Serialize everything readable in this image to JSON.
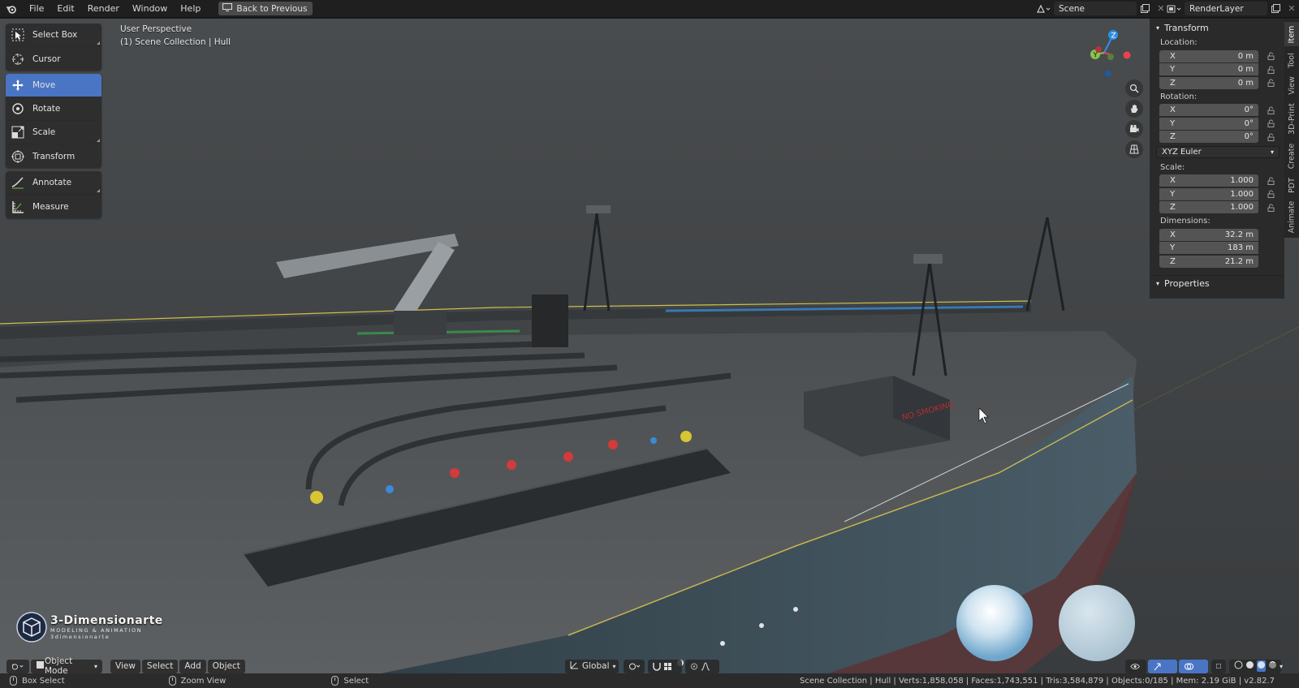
{
  "topbar": {
    "menus": [
      "File",
      "Edit",
      "Render",
      "Window",
      "Help"
    ],
    "back_button": "Back to Previous",
    "scene": "Scene",
    "view_layer": "RenderLayer"
  },
  "viewport": {
    "perspective_label": "User Perspective",
    "collection_label": "(1) Scene Collection | Hull",
    "deck_sign_text": "NO SMOKING"
  },
  "toolbar": {
    "tools": [
      {
        "label": "Select Box",
        "icon": "select-box-icon"
      },
      {
        "label": "Cursor",
        "icon": "cursor-icon"
      },
      {
        "label": "Move",
        "icon": "move-icon",
        "active": true
      },
      {
        "label": "Rotate",
        "icon": "rotate-icon"
      },
      {
        "label": "Scale",
        "icon": "scale-icon"
      },
      {
        "label": "Transform",
        "icon": "transform-icon"
      },
      {
        "label": "Annotate",
        "icon": "annotate-icon"
      },
      {
        "label": "Measure",
        "icon": "measure-icon"
      }
    ]
  },
  "gizmo": {
    "x": "X",
    "y": "Y",
    "z": "Z"
  },
  "npanel": {
    "transform_title": "Transform",
    "location_label": "Location:",
    "location": {
      "x": "0 m",
      "y": "0 m",
      "z": "0 m"
    },
    "rotation_label": "Rotation:",
    "rotation": {
      "x": "0°",
      "y": "0°",
      "z": "0°"
    },
    "rotation_mode": "XYZ Euler",
    "scale_label": "Scale:",
    "scale": {
      "x": "1.000",
      "y": "1.000",
      "z": "1.000"
    },
    "dimensions_label": "Dimensions:",
    "dimensions": {
      "x": "32.2 m",
      "y": "183 m",
      "z": "21.2 m"
    },
    "properties_title": "Properties",
    "axis_x": "X",
    "axis_y": "Y",
    "axis_z": "Z"
  },
  "side_tabs": [
    "Item",
    "Tool",
    "View",
    "3D-Print",
    "Create",
    "PDT",
    "Animate"
  ],
  "header": {
    "mode": "Object Mode",
    "menus": [
      "View",
      "Select",
      "Add",
      "Object"
    ],
    "orientation": "Global"
  },
  "watermark": {
    "title": "3-Dimensionarte",
    "subtitle": "MODELING & ANIMATION",
    "url": "3dimensionarte"
  },
  "statusbar": {
    "left_action": "Box Select",
    "middle_action": "Zoom View",
    "right_action": "Select",
    "stats": "Scene Collection | Hull | Verts:1,858,058 | Faces:1,743,551 | Tris:3,584,879 | Objects:0/185 | Mem: 2.19 GiB | v2.82.7"
  },
  "colors": {
    "active_tool": "#4a75c4",
    "axis_x": "#e8434f",
    "axis_y": "#8bc34a",
    "axis_z": "#2c8ee8"
  }
}
